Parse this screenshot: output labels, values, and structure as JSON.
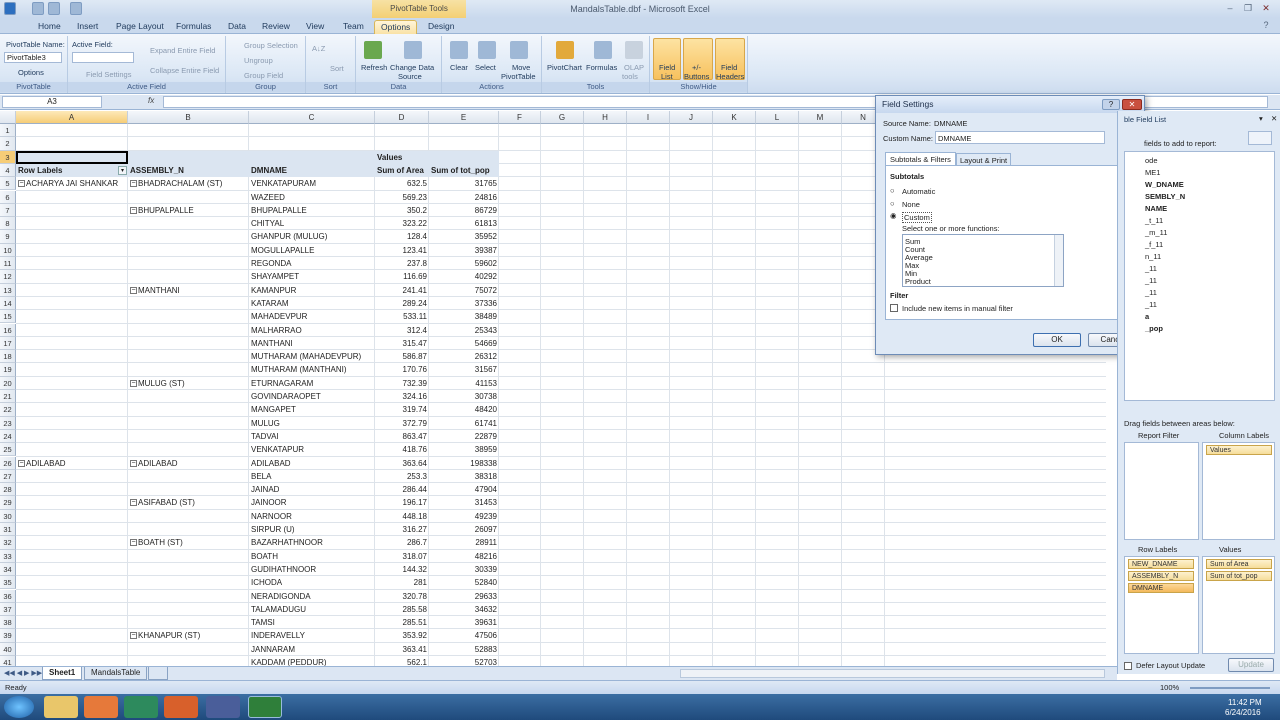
{
  "window": {
    "title": "MandalsTable.dbf - Microsoft Excel",
    "context_tools": "PivotTable Tools"
  },
  "tabs": [
    "Home",
    "Insert",
    "Page Layout",
    "Formulas",
    "Data",
    "Review",
    "View",
    "Team",
    "Options",
    "Design"
  ],
  "active_tab": "Options",
  "ribbon": {
    "pivottable": {
      "name_label": "PivotTable Name:",
      "name_value": "PivotTable3",
      "options": "Options",
      "group": "PivotTable"
    },
    "activefield": {
      "label": "Active Field:",
      "value": "",
      "field_settings": "Field Settings",
      "expand": "Expand Entire Field",
      "collapse": "Collapse Entire Field",
      "group": "Active Field"
    },
    "group": {
      "selection": "Group Selection",
      "ungroup": "Ungroup",
      "field": "Group Field",
      "group": "Group"
    },
    "sort": {
      "sort": "Sort",
      "group": "Sort"
    },
    "data": {
      "refresh": "Refresh",
      "change1": "Change Data",
      "change2": "Source",
      "group": "Data"
    },
    "actions": {
      "clear": "Clear",
      "select": "Select",
      "move1": "Move",
      "move2": "PivotTable",
      "group": "Actions"
    },
    "tools": {
      "chart": "PivotChart",
      "formulas": "Formulas",
      "olap1": "OLAP",
      "olap2": "tools",
      "group": "Tools"
    },
    "showhide": {
      "fl1": "Field",
      "fl2": "List",
      "pm1": "+/-",
      "pm2": "Buttons",
      "fh1": "Field",
      "fh2": "Headers",
      "group": "Show/Hide"
    }
  },
  "namebox": "A3",
  "fx": "fx",
  "columns": [
    "A",
    "B",
    "C",
    "D",
    "E",
    "F",
    "G",
    "H",
    "I",
    "J",
    "K",
    "L",
    "M",
    "N"
  ],
  "pivot": {
    "values_label": "Values",
    "headers": [
      "Row Labels",
      "ASSEMBLY_N",
      "DMNAME",
      "Sum of Area",
      "Sum of tot_pop"
    ],
    "rows": [
      [
        "ACHARYA JAI SHANKAR",
        "BHADRACHALAM (ST)",
        "VENKATAPURAM",
        "632.5",
        "31765"
      ],
      [
        "",
        "",
        "WAZEED",
        "569.23",
        "24816"
      ],
      [
        "",
        "BHUPALPALLE",
        "BHUPALPALLE",
        "350.2",
        "86729"
      ],
      [
        "",
        "",
        "CHITYAL",
        "323.22",
        "61813"
      ],
      [
        "",
        "",
        "GHANPUR (MULUG)",
        "128.4",
        "35952"
      ],
      [
        "",
        "",
        "MOGULLAPALLE",
        "123.41",
        "39387"
      ],
      [
        "",
        "",
        "REGONDA",
        "237.8",
        "59602"
      ],
      [
        "",
        "",
        "SHAYAMPET",
        "116.69",
        "40292"
      ],
      [
        "",
        "MANTHANI",
        "KAMANPUR",
        "241.41",
        "75072"
      ],
      [
        "",
        "",
        "KATARAM",
        "289.24",
        "37336"
      ],
      [
        "",
        "",
        "MAHADEVPUR",
        "533.11",
        "38489"
      ],
      [
        "",
        "",
        "MALHARRAO",
        "312.4",
        "25343"
      ],
      [
        "",
        "",
        "MANTHANI",
        "315.47",
        "54669"
      ],
      [
        "",
        "",
        "MUTHARAM (MAHADEVPUR)",
        "586.87",
        "26312"
      ],
      [
        "",
        "",
        "MUTHARAM (MANTHANI)",
        "170.76",
        "31567"
      ],
      [
        "",
        "MULUG (ST)",
        "ETURNAGARAM",
        "732.39",
        "41153"
      ],
      [
        "",
        "",
        "GOVINDARAOPET",
        "324.16",
        "30738"
      ],
      [
        "",
        "",
        "MANGAPET",
        "319.74",
        "48420"
      ],
      [
        "",
        "",
        "MULUG",
        "372.79",
        "61741"
      ],
      [
        "",
        "",
        "TADVAI",
        "863.47",
        "22879"
      ],
      [
        "",
        "",
        "VENKATAPUR",
        "418.76",
        "38959"
      ],
      [
        "ADILABAD",
        "ADILABAD",
        "ADILABAD",
        "363.64",
        "198338"
      ],
      [
        "",
        "",
        "BELA",
        "253.3",
        "38318"
      ],
      [
        "",
        "",
        "JAINAD",
        "286.44",
        "47904"
      ],
      [
        "",
        "ASIFABAD (ST)",
        "JAINOOR",
        "196.17",
        "31453"
      ],
      [
        "",
        "",
        "NARNOOR",
        "448.18",
        "49239"
      ],
      [
        "",
        "",
        "SIRPUR (U)",
        "316.27",
        "26097"
      ],
      [
        "",
        "BOATH (ST)",
        "BAZARHATHNOOR",
        "286.7",
        "28911"
      ],
      [
        "",
        "",
        "BOATH",
        "318.07",
        "48216"
      ],
      [
        "",
        "",
        "GUDIHATHNOOR",
        "144.32",
        "30339"
      ],
      [
        "",
        "",
        "ICHODA",
        "281",
        "52840"
      ],
      [
        "",
        "",
        "NERADIGONDA",
        "320.78",
        "29633"
      ],
      [
        "",
        "",
        "TALAMADUGU",
        "285.58",
        "34632"
      ],
      [
        "",
        "",
        "TAMSI",
        "285.51",
        "39631"
      ],
      [
        "",
        "KHANAPUR (ST)",
        "INDERAVELLY",
        "353.92",
        "47506"
      ],
      [
        "",
        "",
        "JANNARAM",
        "363.41",
        "52883"
      ],
      [
        "",
        "",
        "KADDAM (PEDDUR)",
        "562.1",
        "52703"
      ]
    ]
  },
  "dialog": {
    "title": "Field Settings",
    "source_label": "Source Name:",
    "source_value": "DMNAME",
    "custom_label": "Custom Name:",
    "custom_value": "DMNAME",
    "tab1": "Subtotals & Filters",
    "tab2": "Layout & Print",
    "subtotals": "Subtotals",
    "automatic": "Automatic",
    "none": "None",
    "custom": "Custom",
    "select_label": "Select one or more functions:",
    "functions": [
      "Sum",
      "Count",
      "Average",
      "Max",
      "Min",
      "Product"
    ],
    "filter": "Filter",
    "include": "Include new items in manual filter",
    "ok": "OK",
    "cancel": "Cancel"
  },
  "fieldlist": {
    "title": "ble Field List",
    "choose": "fields to add to report:",
    "fields": [
      "ode",
      "ME1",
      "W_DNAME",
      "SEMBLY_N",
      "NAME",
      "_t_11",
      "_m_11",
      "_f_11",
      "n_11",
      "_11",
      "_11",
      "_11",
      "_11",
      "a",
      "_pop"
    ],
    "drag_label": "Drag fields between areas below:",
    "report_filter": "Report Filter",
    "column_labels": "Column Labels",
    "row_labels": "Row Labels",
    "values": "Values",
    "col_chips": [
      "Values"
    ],
    "row_chips": [
      "NEW_DNAME",
      "ASSEMBLY_N",
      "DMNAME"
    ],
    "value_chips": [
      "Sum of Area",
      "Sum of tot_pop"
    ],
    "defer": "Defer Layout Update",
    "update": "Update"
  },
  "sheets": [
    "Sheet1",
    "MandalsTable"
  ],
  "active_sheet": "Sheet1",
  "status": "Ready",
  "zoom": "100%",
  "clock": {
    "time": "11:42 PM",
    "date": "6/24/2016"
  }
}
